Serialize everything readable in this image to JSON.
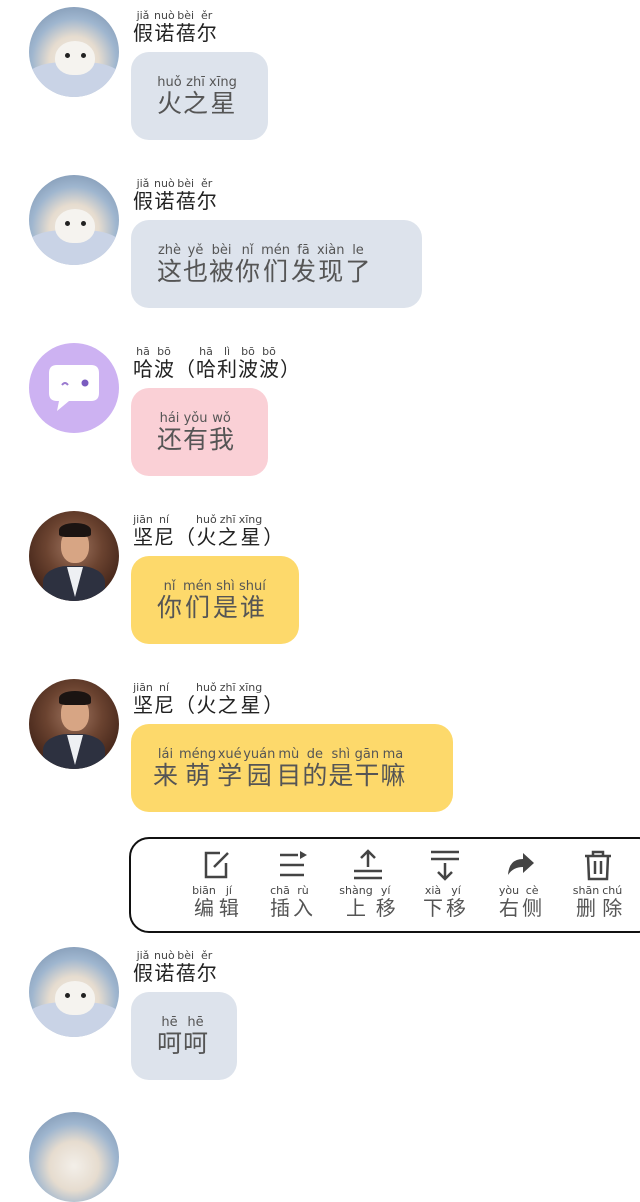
{
  "messages": [
    {
      "speaker": {
        "chars": [
          [
            "jiǎ",
            "假"
          ],
          [
            "nuò",
            "诺"
          ],
          [
            "bèi",
            "蓓"
          ],
          [
            "ěr",
            "尔"
          ]
        ]
      },
      "text": [
        [
          "huǒ",
          "火"
        ],
        [
          "zhī",
          "之"
        ],
        [
          "xīng",
          "星"
        ]
      ]
    },
    {
      "speaker": {
        "chars": [
          [
            "jiǎ",
            "假"
          ],
          [
            "nuò",
            "诺"
          ],
          [
            "bèi",
            "蓓"
          ],
          [
            "ěr",
            "尔"
          ]
        ]
      },
      "text": [
        [
          "zhè",
          "这"
        ],
        [
          "yě",
          "也"
        ],
        [
          "bèi",
          "被"
        ],
        [
          "nǐ",
          "你"
        ],
        [
          "mén",
          "们"
        ],
        [
          "fā",
          "发"
        ],
        [
          "xiàn",
          "现"
        ],
        [
          "le",
          "了"
        ]
      ]
    },
    {
      "speaker": {
        "chars": [
          [
            "hā",
            "哈"
          ],
          [
            "bō",
            "波"
          ],
          [
            "",
            "（"
          ],
          [
            "hā",
            "哈"
          ],
          [
            "lì",
            "利"
          ],
          [
            "bō",
            "波"
          ],
          [
            "bō",
            "波"
          ],
          [
            "",
            "）"
          ]
        ]
      },
      "text": [
        [
          "hái",
          "还"
        ],
        [
          "yǒu",
          "有"
        ],
        [
          "wǒ",
          "我"
        ]
      ]
    },
    {
      "speaker": {
        "chars": [
          [
            "jiān",
            "坚"
          ],
          [
            "ní",
            "尼"
          ],
          [
            "",
            "（"
          ],
          [
            "huǒ",
            "火"
          ],
          [
            "zhī",
            "之"
          ],
          [
            "xīng",
            "星"
          ],
          [
            "",
            "）"
          ]
        ]
      },
      "text": [
        [
          "nǐ",
          "你"
        ],
        [
          "mén",
          "们"
        ],
        [
          "shì",
          "是"
        ],
        [
          "shuí",
          "谁"
        ]
      ]
    },
    {
      "speaker": {
        "chars": [
          [
            "jiān",
            "坚"
          ],
          [
            "ní",
            "尼"
          ],
          [
            "",
            "（"
          ],
          [
            "huǒ",
            "火"
          ],
          [
            "zhī",
            "之"
          ],
          [
            "xīng",
            "星"
          ],
          [
            "",
            "）"
          ]
        ]
      },
      "text": [
        [
          "lái",
          "来"
        ],
        [
          "méng",
          "萌"
        ],
        [
          "xué",
          "学"
        ],
        [
          "yuán",
          "园"
        ],
        [
          "mù",
          "目"
        ],
        [
          "de",
          "的"
        ],
        [
          "shì",
          "是"
        ],
        [
          "gān",
          "干"
        ],
        [
          "ma",
          "嘛"
        ]
      ]
    },
    {
      "speaker": {
        "chars": [
          [
            "jiǎ",
            "假"
          ],
          [
            "nuò",
            "诺"
          ],
          [
            "bèi",
            "蓓"
          ],
          [
            "ěr",
            "尔"
          ]
        ]
      },
      "text": [
        [
          "hē",
          "呵"
        ],
        [
          "hē",
          "呵"
        ]
      ]
    }
  ],
  "toolbar": [
    {
      "icon": "edit-icon",
      "label": [
        [
          "biān",
          "编"
        ],
        [
          "jí",
          "辑"
        ]
      ]
    },
    {
      "icon": "insert-icon",
      "label": [
        [
          "chā",
          "插"
        ],
        [
          "rù",
          "入"
        ]
      ]
    },
    {
      "icon": "move-up-icon",
      "label": [
        [
          "shàng",
          "上"
        ],
        [
          "yí",
          "移"
        ]
      ]
    },
    {
      "icon": "move-down-icon",
      "label": [
        [
          "xià",
          "下"
        ],
        [
          "yí",
          "移"
        ]
      ]
    },
    {
      "icon": "right-side-icon",
      "label": [
        [
          "yòu",
          "右"
        ],
        [
          "cè",
          "侧"
        ]
      ]
    },
    {
      "icon": "delete-icon",
      "label": [
        [
          "shān",
          "删"
        ],
        [
          "chú",
          "除"
        ]
      ]
    }
  ],
  "colors": {
    "gray_bubble": "#dde3ec",
    "pink_bubble": "#fad0d6",
    "yellow_bubble": "#fdd96b",
    "bot_avatar": "#cdb2f2"
  }
}
